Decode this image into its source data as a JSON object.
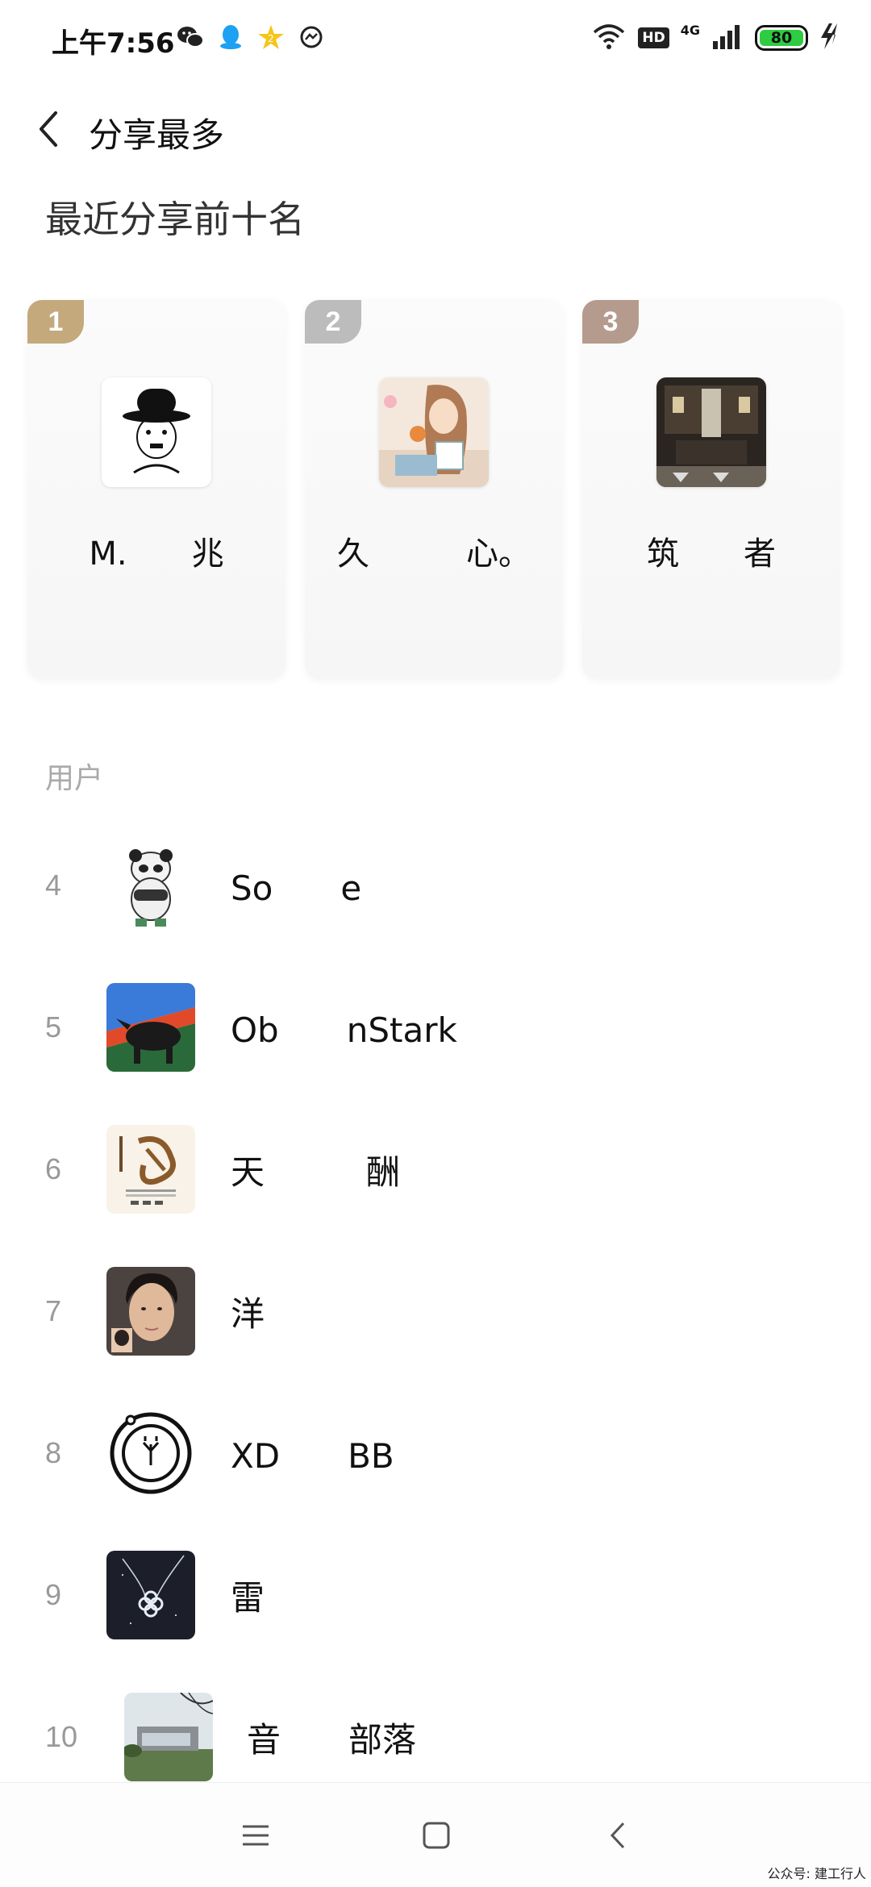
{
  "status_bar": {
    "time": "上午7:56",
    "hd": "HD",
    "network": "4G",
    "battery": "80",
    "app_icons": [
      "wechat-icon",
      "qq-icon",
      "star-badge-icon",
      "messenger-icon"
    ]
  },
  "header": {
    "title": "分享最多"
  },
  "section_title": "最近分享前十名",
  "top_three": [
    {
      "rank": "1",
      "name": "M.　　兆"
    },
    {
      "rank": "2",
      "name": "久　　　心。"
    },
    {
      "rank": "3",
      "name": "筑　　者"
    }
  ],
  "users_label": "用户",
  "users": [
    {
      "rank": "4",
      "name": "So　　e"
    },
    {
      "rank": "5",
      "name": "Ob　　nStark"
    },
    {
      "rank": "6",
      "name": "天　　　酬"
    },
    {
      "rank": "7",
      "name": "洋"
    },
    {
      "rank": "8",
      "name": "XD　　BB"
    },
    {
      "rank": "9",
      "name": "雷"
    },
    {
      "rank": "10",
      "name": "音　　部落"
    }
  ],
  "watermark": "公众号: 建工行人",
  "colors": {
    "rank1": "#c4a97d",
    "rank2": "#bcbcbc",
    "rank3": "#b59b8e",
    "battery": "#2ecc40"
  }
}
